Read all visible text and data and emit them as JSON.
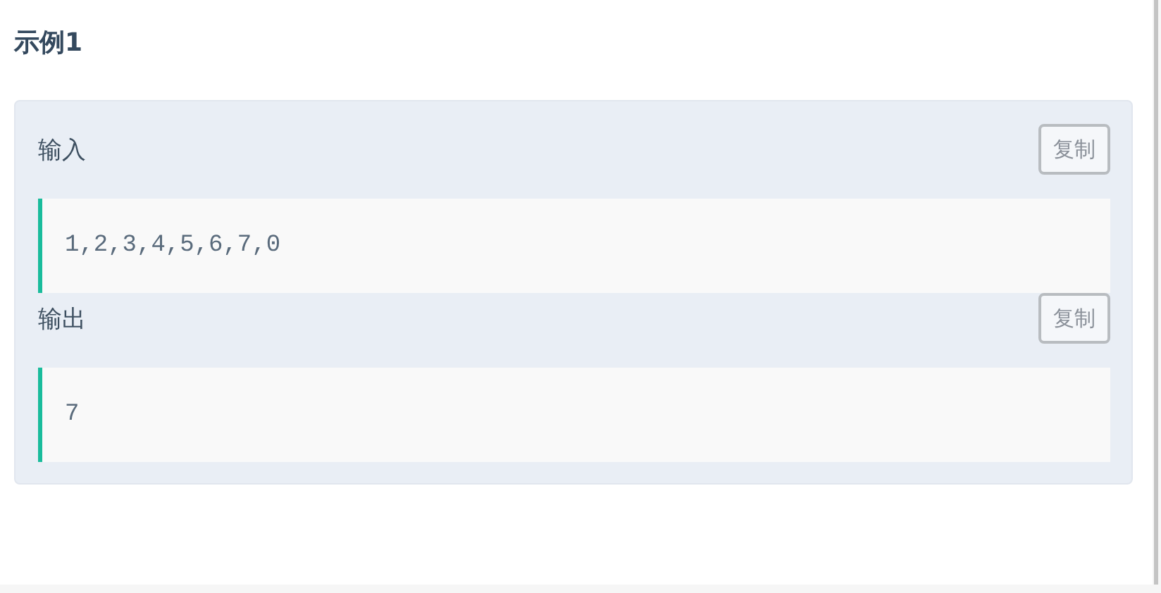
{
  "title": "示例1",
  "sections": [
    {
      "label": "输入",
      "copy_button": "复制",
      "code": "1,2,3,4,5,6,7,0"
    },
    {
      "label": "输出",
      "copy_button": "复制",
      "code": "7"
    }
  ]
}
